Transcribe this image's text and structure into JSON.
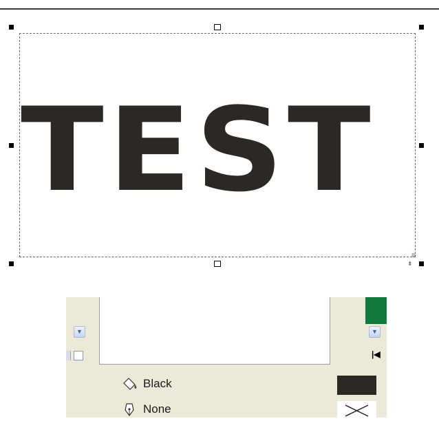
{
  "canvas": {
    "artwork_text": "TEST"
  },
  "properties": {
    "fill": {
      "label": "Black",
      "icon": "paint-bucket-icon",
      "color": "#2b2826"
    },
    "outline": {
      "label": "None",
      "icon": "pen-nib-icon"
    }
  },
  "colors": {
    "panel_background": "#ece9d8",
    "selected_swatch": "#117a3d"
  }
}
